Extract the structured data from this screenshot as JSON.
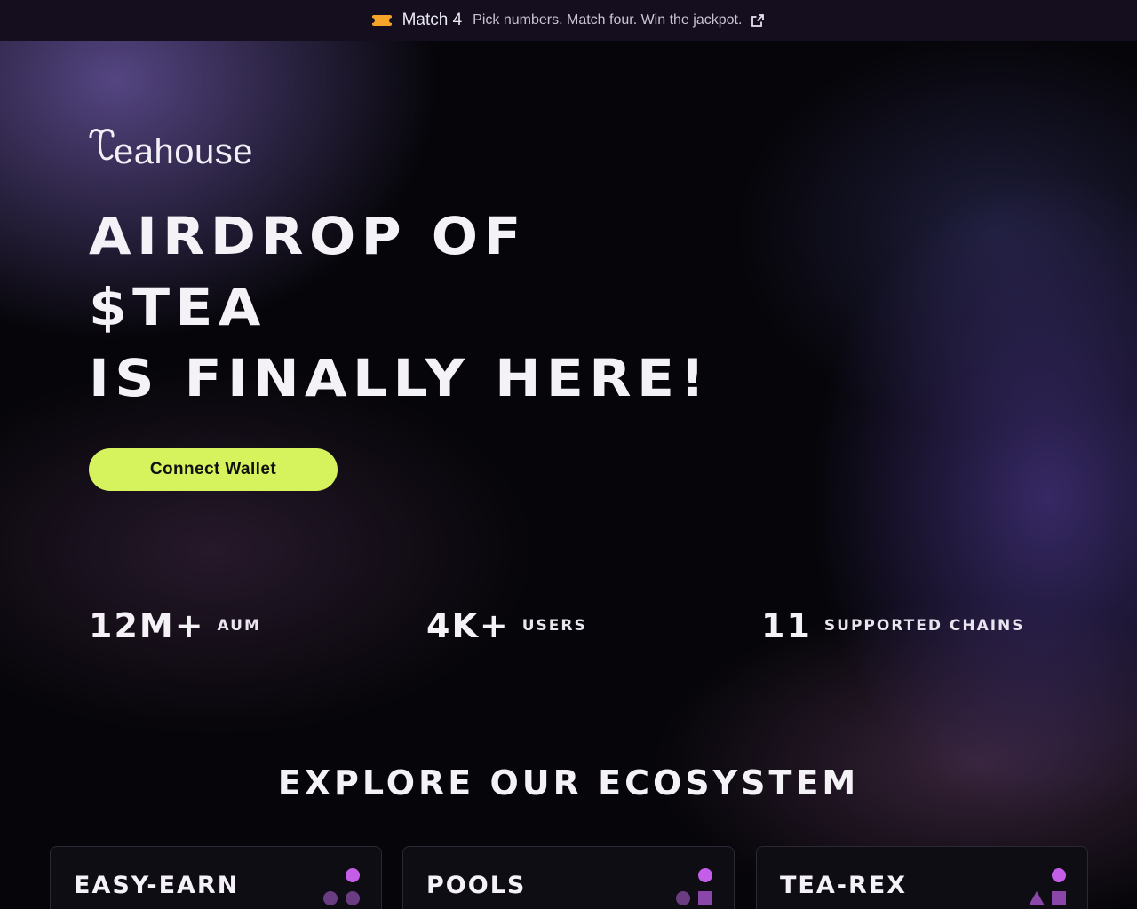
{
  "banner": {
    "title": "Match 4",
    "text": "Pick numbers. Match four. Win the jackpot.",
    "icon": "ticket-icon",
    "link_icon": "external-link-icon"
  },
  "logo": {
    "text": "eahouse"
  },
  "hero": {
    "headline": [
      "AIRDROP OF",
      "$TEA",
      "IS FINALLY HERE!"
    ],
    "cta_label": "Connect Wallet"
  },
  "stats": [
    {
      "value": "12M+",
      "label": "AUM"
    },
    {
      "value": "4K+",
      "label": "USERS"
    },
    {
      "value": "11",
      "label": "SUPPORTED CHAINS"
    }
  ],
  "ecosystem": {
    "title": "EXPLORE OUR ECOSYSTEM",
    "cards": [
      {
        "title": "EASY-EARN",
        "icon": "circles-icon"
      },
      {
        "title": "POOLS",
        "icon": "circles-square-icon"
      },
      {
        "title": "TEA-REX",
        "icon": "shapes-icon"
      }
    ]
  },
  "colors": {
    "accent": "#d6f25c",
    "banner_bg": "#140e1f",
    "icon_purple": "#c45ee8",
    "icon_dark_purple": "#6a3c82"
  }
}
